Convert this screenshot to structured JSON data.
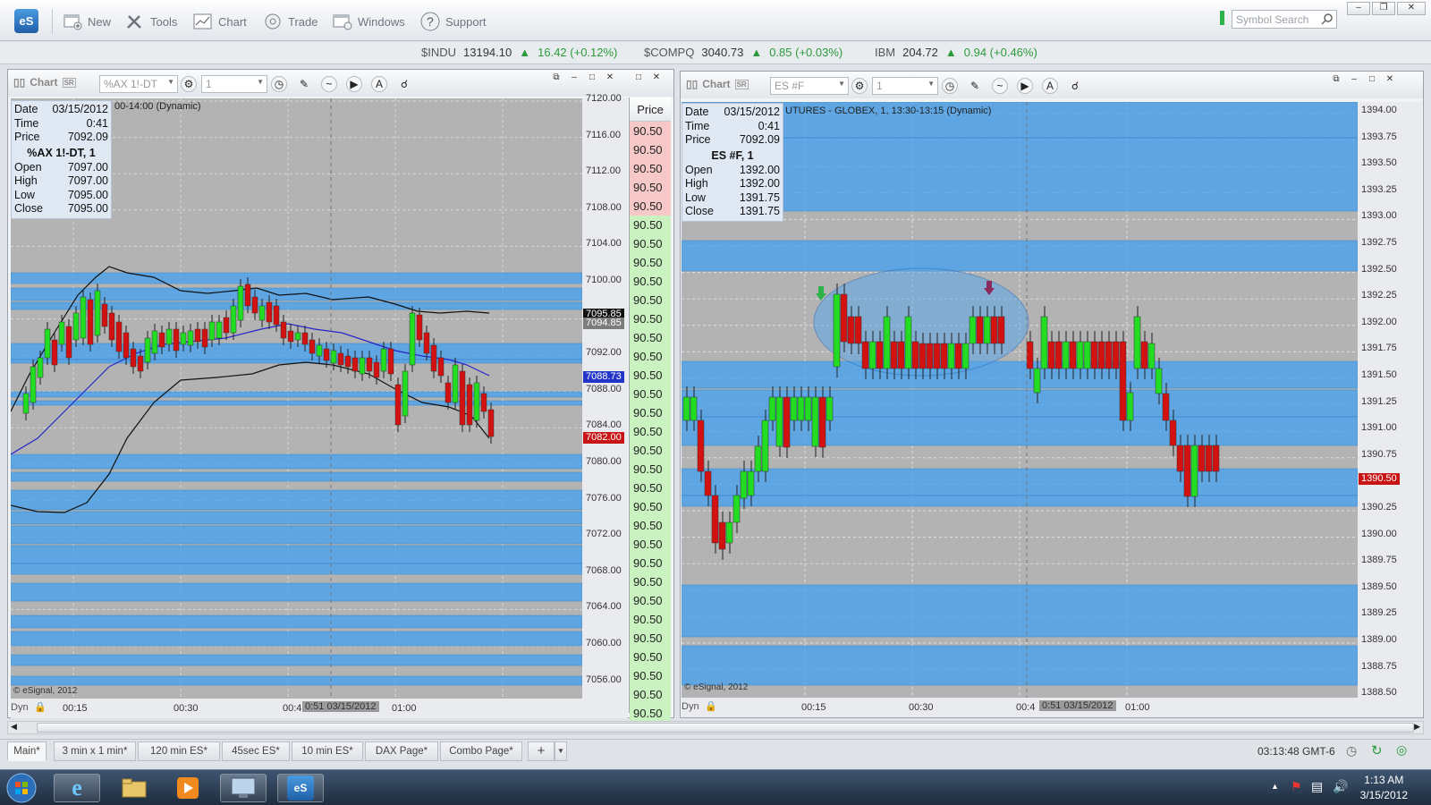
{
  "app": {
    "logo": "eS"
  },
  "toolbar": {
    "items": [
      {
        "label": "New",
        "icon": "new-window-icon"
      },
      {
        "label": "Tools",
        "icon": "tools-icon"
      },
      {
        "label": "Chart",
        "icon": "chart-icon"
      },
      {
        "label": "Trade",
        "icon": "trade-icon"
      },
      {
        "label": "Windows",
        "icon": "windows-icon"
      },
      {
        "label": "Support",
        "icon": "help-icon"
      }
    ],
    "search_placeholder": "Symbol Search"
  },
  "ticker": [
    {
      "symbol": "$INDU",
      "value": "13194.10",
      "change": "16.42 (+0.12%)"
    },
    {
      "symbol": "$COMPQ",
      "value": "3040.73",
      "change": "0.85 (+0.03%)"
    },
    {
      "symbol": "IBM",
      "value": "204.72",
      "change": "0.94 (+0.46%)"
    }
  ],
  "left_chart": {
    "title": "Chart",
    "symbol": "%AX 1!-DT",
    "interval": "1",
    "session": "00-14:00 (Dynamic)",
    "info": {
      "date_label": "Date",
      "date": "03/15/2012",
      "time_label": "Time",
      "time": "0:41",
      "price_label": "Price",
      "price": "7092.09",
      "title": "%AX 1!-DT, 1",
      "open_label": "Open",
      "open": "7097.00",
      "high_label": "High",
      "high": "7097.00",
      "low_label": "Low",
      "low": "7095.00",
      "close_label": "Close",
      "close": "7095.00"
    },
    "y_ticks": [
      "7120.00",
      "7116.00",
      "7112.00",
      "7108.00",
      "7104.00",
      "7100.00",
      "7096.00",
      "7092.00",
      "7088.00",
      "7084.00",
      "7080.00",
      "7076.00",
      "7072.00",
      "7068.00",
      "7064.00",
      "7060.00",
      "7056.00"
    ],
    "price_tags": [
      {
        "text": "7095.85",
        "color": "#111111"
      },
      {
        "text": "7094.85",
        "color": "#7d7d7d"
      },
      {
        "text": "7088.73",
        "color": "#2235c8"
      },
      {
        "text": "7082.00",
        "color": "#c81414"
      }
    ],
    "x_labels": [
      "00:15",
      "00:30",
      "00:4",
      "01:00"
    ],
    "cursor_time": "0:51 03/15/2012",
    "copyright": "© eSignal, 2012",
    "dyn": "Dyn"
  },
  "ladder": {
    "header": "Price",
    "rows": [
      "90.50",
      "90.50",
      "90.50",
      "90.50",
      "90.50",
      "90.50",
      "90.50",
      "90.50",
      "90.50",
      "90.50",
      "90.50",
      "90.50",
      "90.50",
      "90.50",
      "90.50",
      "90.50",
      "90.50",
      "90.50",
      "90.50",
      "90.50",
      "90.50",
      "90.50",
      "90.50",
      "90.50",
      "90.50",
      "90.50",
      "90.50",
      "90.50",
      "90.50",
      "90.50",
      "90.50",
      "90.50"
    ],
    "red_rows": 5
  },
  "right_chart": {
    "title": "Chart",
    "symbol": "ES #F",
    "interval": "1",
    "session": "UTURES - GLOBEX, 1, 13:30-13:15 (Dynamic)",
    "info": {
      "date_label": "Date",
      "date": "03/15/2012",
      "time_label": "Time",
      "time": "0:41",
      "price_label": "Price",
      "price": "7092.09",
      "title": "ES #F, 1",
      "open_label": "Open",
      "open": "1392.00",
      "high_label": "High",
      "high": "1392.00",
      "low_label": "Low",
      "low": "1391.75",
      "close_label": "Close",
      "close": "1391.75"
    },
    "y_ticks": [
      "1394.00",
      "1393.75",
      "1393.50",
      "1393.25",
      "1393.00",
      "1392.75",
      "1392.50",
      "1392.25",
      "1392.00",
      "1391.75",
      "1391.50",
      "1391.25",
      "1391.00",
      "1390.75",
      "1390.50",
      "1390.25",
      "1390.00",
      "1389.75",
      "1389.50",
      "1389.25",
      "1389.00",
      "1388.75",
      "1388.50"
    ],
    "price_tag": {
      "text": "1390.50",
      "color": "#c81414"
    },
    "x_labels": [
      "00:15",
      "00:30",
      "00:4",
      "01:00"
    ],
    "cursor_time": "0:51 03/15/2012",
    "copyright": "© eSignal, 2012",
    "dyn": "Dyn"
  },
  "tabs": [
    "Main*",
    "3 min x 1 min*",
    "120 min ES*",
    "45sec ES*",
    "10 min ES*",
    "DAX Page*",
    "Combo Page*"
  ],
  "status": {
    "time": "03:13:48 GMT-6"
  },
  "taskbar": {
    "time": "1:13 AM",
    "date": "3/15/2012"
  },
  "colors": {
    "up": "#22dd22",
    "down": "#d41111",
    "band": "#3ea0f4"
  }
}
